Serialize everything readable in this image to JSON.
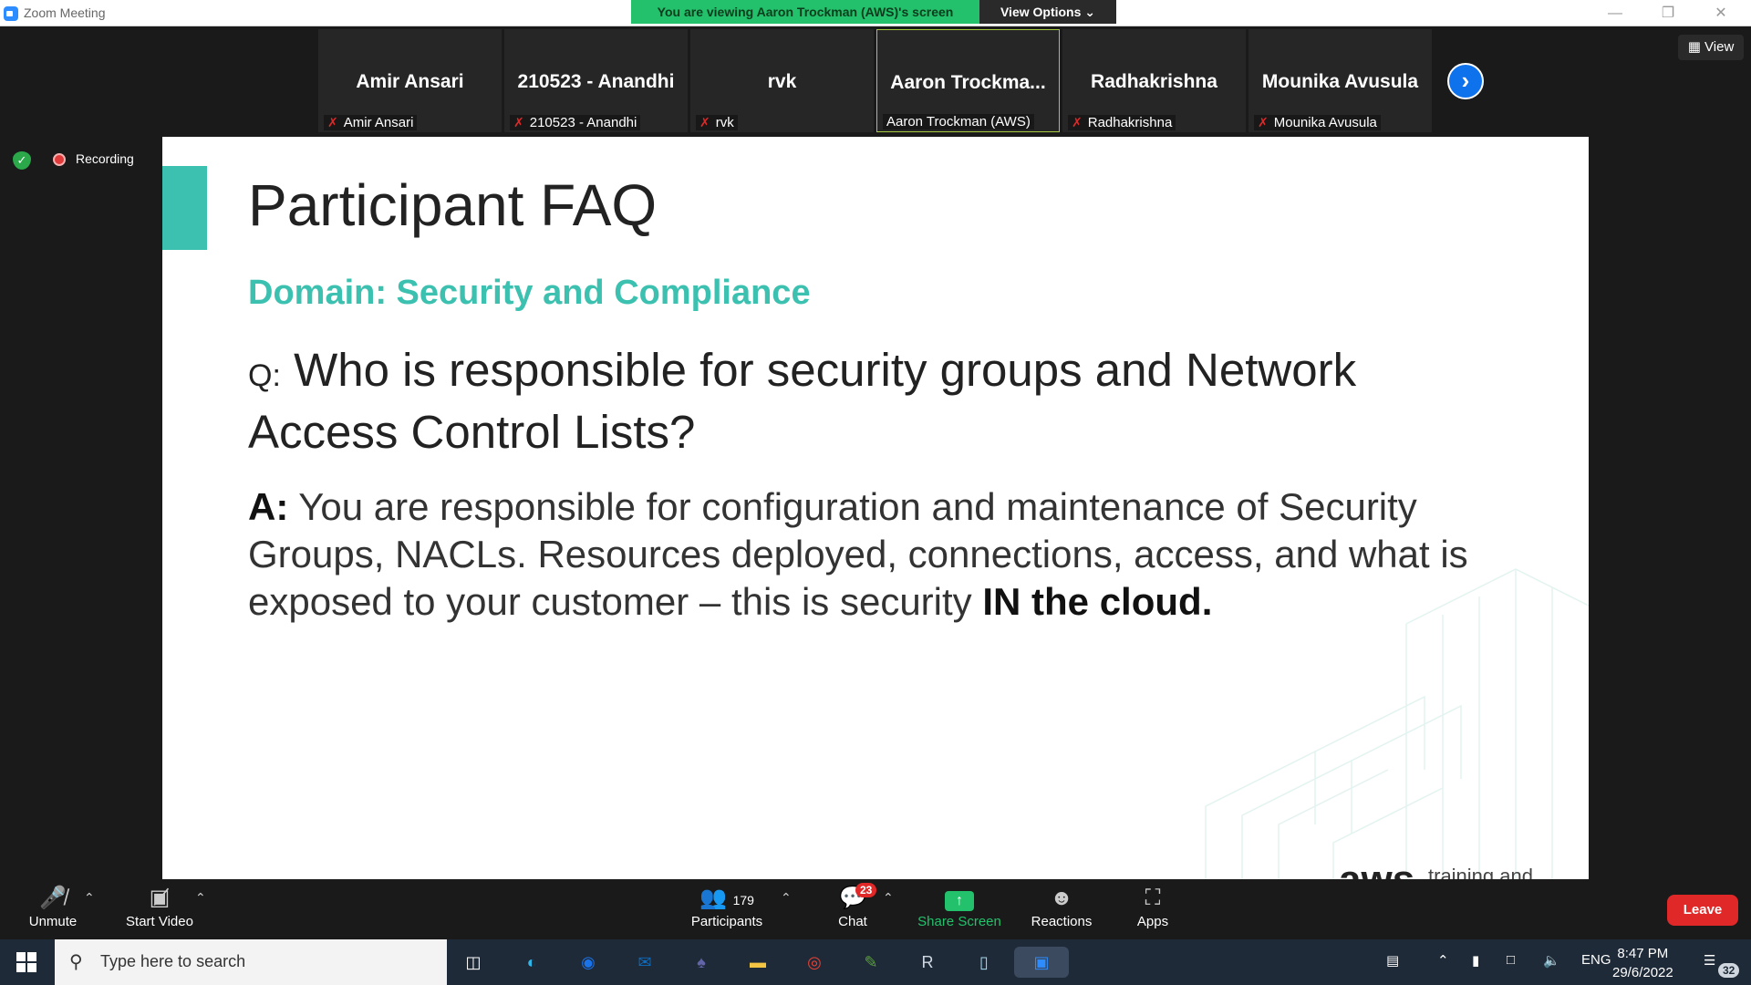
{
  "window": {
    "title": "Zoom Meeting",
    "viewing_banner": "You are viewing Aaron Trockman (AWS)'s screen",
    "view_options_label": "View Options ⌄",
    "view_label": "View"
  },
  "gallery": {
    "participants": [
      {
        "display": "Amir Ansari",
        "label": "Amir Ansari"
      },
      {
        "display": "210523 - Anandhi",
        "label": "210523 - Anandhi"
      },
      {
        "display": "rvk",
        "label": "rvk"
      },
      {
        "display": "Aaron Trockma...",
        "label": "Aaron Trockman (AWS)"
      },
      {
        "display": "Radhakrishna",
        "label": "Radhakrishna"
      },
      {
        "display": "Mounika Avusula",
        "label": "Mounika Avusula"
      }
    ]
  },
  "status": {
    "recording_label": "Recording"
  },
  "slide": {
    "title": "Participant FAQ",
    "domain": "Domain: Security and Compliance",
    "question_prefix": "Q:",
    "question": "Who is responsible for security groups and Network Access Control Lists?",
    "answer_prefix": "A:",
    "answer": "You are responsible for configuration and maintenance of Security Groups, NACLs. Resources deployed, connections, access, and what is exposed to your customer – this is security",
    "answer_emphasis": "IN the cloud.",
    "brand": "aws",
    "brand_sub": "training and"
  },
  "toolbar": {
    "unmute": "Unmute",
    "start_video": "Start Video",
    "participants": "Participants",
    "participants_count": "179",
    "chat": "Chat",
    "chat_badge": "23",
    "share_screen": "Share Screen",
    "reactions": "Reactions",
    "apps": "Apps",
    "leave": "Leave"
  },
  "taskbar": {
    "search_placeholder": "Type here to search",
    "language": "ENG",
    "time": "8:47 PM",
    "date": "29/6/2022",
    "notification_count": "32"
  },
  "colors": {
    "accent_teal": "#3cc1b0",
    "banner_green": "#23c16b",
    "leave_red": "#e02828",
    "zoom_blue": "#0e72ed"
  }
}
